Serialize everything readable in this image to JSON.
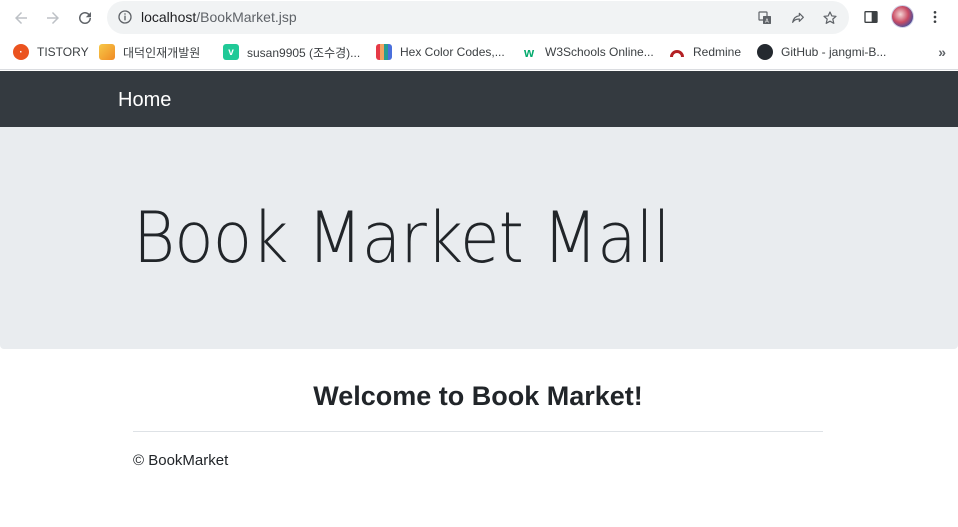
{
  "browser": {
    "url_host": "localhost",
    "url_path": "/BookMarket.jsp"
  },
  "bookmarks": {
    "items": [
      {
        "label": "TISTORY",
        "icon": "tistory-icon",
        "color": "#eb531f"
      },
      {
        "label": "대덕인재개발원",
        "icon": "daedeok-icon",
        "color": "#f5a623"
      },
      {
        "label": "susan9905 (조수경)...",
        "icon": "velog-icon",
        "color": "#20c997"
      },
      {
        "label": "Hex Color Codes,...",
        "icon": "hex-color-icon",
        "color": "#4a6fdc"
      },
      {
        "label": "W3Schools Online...",
        "icon": "w3schools-icon",
        "color": "#04aa6d"
      },
      {
        "label": "Redmine",
        "icon": "redmine-icon",
        "color": "#b32024"
      },
      {
        "label": "GitHub - jangmi-B...",
        "icon": "github-icon",
        "color": "#24292f"
      }
    ],
    "more": "»"
  },
  "navbar": {
    "brand": "Home",
    "bg_color": "#343a40"
  },
  "jumbotron": {
    "title": "Book Market Mall",
    "bg_color": "#e9ecef"
  },
  "main": {
    "welcome": "Welcome to Book Market!"
  },
  "footer": {
    "copyright": "© BookMarket"
  }
}
